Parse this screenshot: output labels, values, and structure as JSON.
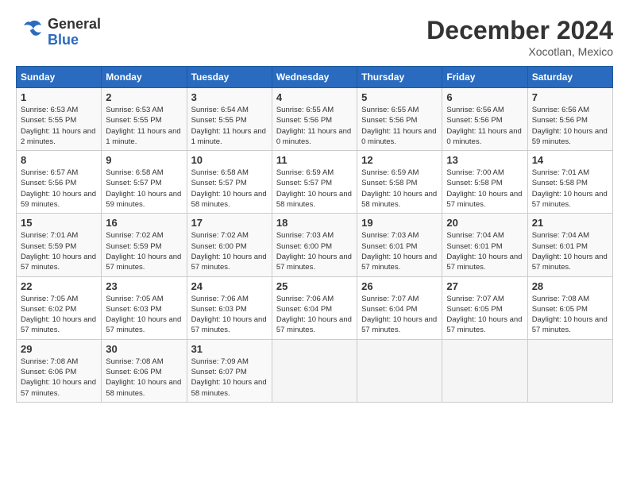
{
  "header": {
    "logo_general": "General",
    "logo_blue": "Blue",
    "month_title": "December 2024",
    "location": "Xocotlan, Mexico"
  },
  "columns": [
    "Sunday",
    "Monday",
    "Tuesday",
    "Wednesday",
    "Thursday",
    "Friday",
    "Saturday"
  ],
  "weeks": [
    [
      {
        "day": "1",
        "sunrise": "Sunrise: 6:53 AM",
        "sunset": "Sunset: 5:55 PM",
        "daylight": "Daylight: 11 hours and 2 minutes."
      },
      {
        "day": "2",
        "sunrise": "Sunrise: 6:53 AM",
        "sunset": "Sunset: 5:55 PM",
        "daylight": "Daylight: 11 hours and 1 minute."
      },
      {
        "day": "3",
        "sunrise": "Sunrise: 6:54 AM",
        "sunset": "Sunset: 5:55 PM",
        "daylight": "Daylight: 11 hours and 1 minute."
      },
      {
        "day": "4",
        "sunrise": "Sunrise: 6:55 AM",
        "sunset": "Sunset: 5:56 PM",
        "daylight": "Daylight: 11 hours and 0 minutes."
      },
      {
        "day": "5",
        "sunrise": "Sunrise: 6:55 AM",
        "sunset": "Sunset: 5:56 PM",
        "daylight": "Daylight: 11 hours and 0 minutes."
      },
      {
        "day": "6",
        "sunrise": "Sunrise: 6:56 AM",
        "sunset": "Sunset: 5:56 PM",
        "daylight": "Daylight: 11 hours and 0 minutes."
      },
      {
        "day": "7",
        "sunrise": "Sunrise: 6:56 AM",
        "sunset": "Sunset: 5:56 PM",
        "daylight": "Daylight: 10 hours and 59 minutes."
      }
    ],
    [
      {
        "day": "8",
        "sunrise": "Sunrise: 6:57 AM",
        "sunset": "Sunset: 5:56 PM",
        "daylight": "Daylight: 10 hours and 59 minutes."
      },
      {
        "day": "9",
        "sunrise": "Sunrise: 6:58 AM",
        "sunset": "Sunset: 5:57 PM",
        "daylight": "Daylight: 10 hours and 59 minutes."
      },
      {
        "day": "10",
        "sunrise": "Sunrise: 6:58 AM",
        "sunset": "Sunset: 5:57 PM",
        "daylight": "Daylight: 10 hours and 58 minutes."
      },
      {
        "day": "11",
        "sunrise": "Sunrise: 6:59 AM",
        "sunset": "Sunset: 5:57 PM",
        "daylight": "Daylight: 10 hours and 58 minutes."
      },
      {
        "day": "12",
        "sunrise": "Sunrise: 6:59 AM",
        "sunset": "Sunset: 5:58 PM",
        "daylight": "Daylight: 10 hours and 58 minutes."
      },
      {
        "day": "13",
        "sunrise": "Sunrise: 7:00 AM",
        "sunset": "Sunset: 5:58 PM",
        "daylight": "Daylight: 10 hours and 57 minutes."
      },
      {
        "day": "14",
        "sunrise": "Sunrise: 7:01 AM",
        "sunset": "Sunset: 5:58 PM",
        "daylight": "Daylight: 10 hours and 57 minutes."
      }
    ],
    [
      {
        "day": "15",
        "sunrise": "Sunrise: 7:01 AM",
        "sunset": "Sunset: 5:59 PM",
        "daylight": "Daylight: 10 hours and 57 minutes."
      },
      {
        "day": "16",
        "sunrise": "Sunrise: 7:02 AM",
        "sunset": "Sunset: 5:59 PM",
        "daylight": "Daylight: 10 hours and 57 minutes."
      },
      {
        "day": "17",
        "sunrise": "Sunrise: 7:02 AM",
        "sunset": "Sunset: 6:00 PM",
        "daylight": "Daylight: 10 hours and 57 minutes."
      },
      {
        "day": "18",
        "sunrise": "Sunrise: 7:03 AM",
        "sunset": "Sunset: 6:00 PM",
        "daylight": "Daylight: 10 hours and 57 minutes."
      },
      {
        "day": "19",
        "sunrise": "Sunrise: 7:03 AM",
        "sunset": "Sunset: 6:01 PM",
        "daylight": "Daylight: 10 hours and 57 minutes."
      },
      {
        "day": "20",
        "sunrise": "Sunrise: 7:04 AM",
        "sunset": "Sunset: 6:01 PM",
        "daylight": "Daylight: 10 hours and 57 minutes."
      },
      {
        "day": "21",
        "sunrise": "Sunrise: 7:04 AM",
        "sunset": "Sunset: 6:01 PM",
        "daylight": "Daylight: 10 hours and 57 minutes."
      }
    ],
    [
      {
        "day": "22",
        "sunrise": "Sunrise: 7:05 AM",
        "sunset": "Sunset: 6:02 PM",
        "daylight": "Daylight: 10 hours and 57 minutes."
      },
      {
        "day": "23",
        "sunrise": "Sunrise: 7:05 AM",
        "sunset": "Sunset: 6:03 PM",
        "daylight": "Daylight: 10 hours and 57 minutes."
      },
      {
        "day": "24",
        "sunrise": "Sunrise: 7:06 AM",
        "sunset": "Sunset: 6:03 PM",
        "daylight": "Daylight: 10 hours and 57 minutes."
      },
      {
        "day": "25",
        "sunrise": "Sunrise: 7:06 AM",
        "sunset": "Sunset: 6:04 PM",
        "daylight": "Daylight: 10 hours and 57 minutes."
      },
      {
        "day": "26",
        "sunrise": "Sunrise: 7:07 AM",
        "sunset": "Sunset: 6:04 PM",
        "daylight": "Daylight: 10 hours and 57 minutes."
      },
      {
        "day": "27",
        "sunrise": "Sunrise: 7:07 AM",
        "sunset": "Sunset: 6:05 PM",
        "daylight": "Daylight: 10 hours and 57 minutes."
      },
      {
        "day": "28",
        "sunrise": "Sunrise: 7:08 AM",
        "sunset": "Sunset: 6:05 PM",
        "daylight": "Daylight: 10 hours and 57 minutes."
      }
    ],
    [
      {
        "day": "29",
        "sunrise": "Sunrise: 7:08 AM",
        "sunset": "Sunset: 6:06 PM",
        "daylight": "Daylight: 10 hours and 57 minutes."
      },
      {
        "day": "30",
        "sunrise": "Sunrise: 7:08 AM",
        "sunset": "Sunset: 6:06 PM",
        "daylight": "Daylight: 10 hours and 58 minutes."
      },
      {
        "day": "31",
        "sunrise": "Sunrise: 7:09 AM",
        "sunset": "Sunset: 6:07 PM",
        "daylight": "Daylight: 10 hours and 58 minutes."
      },
      null,
      null,
      null,
      null
    ]
  ]
}
